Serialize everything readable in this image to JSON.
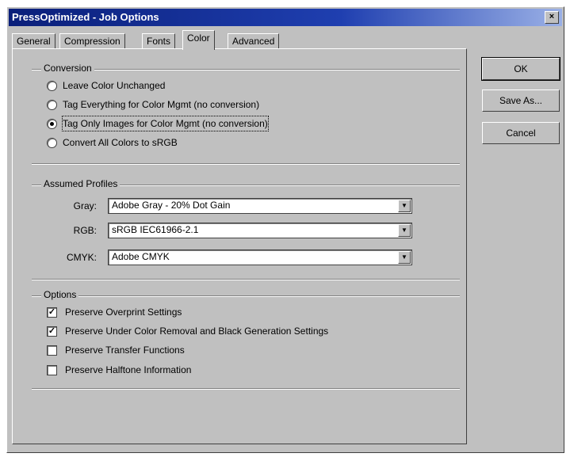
{
  "window": {
    "title": "PressOptimized - Job Options",
    "close_label": "×"
  },
  "tabs": [
    {
      "label": "General"
    },
    {
      "label": "Compression"
    },
    {
      "label": "Fonts"
    },
    {
      "label": "Color"
    },
    {
      "label": "Advanced"
    }
  ],
  "active_tab": "Color",
  "conversion": {
    "group_label": "Conversion",
    "options": [
      {
        "label": "Leave Color Unchanged",
        "selected": false
      },
      {
        "label": "Tag Everything for Color Mgmt (no conversion)",
        "selected": false
      },
      {
        "label": "Tag Only Images for Color Mgmt (no conversion)",
        "selected": true
      },
      {
        "label": "Convert All Colors to sRGB",
        "selected": false
      }
    ]
  },
  "profiles": {
    "group_label": "Assumed Profiles",
    "gray": {
      "label": "Gray:",
      "value": "Adobe Gray - 20% Dot Gain"
    },
    "rgb": {
      "label": "RGB:",
      "value": "sRGB IEC61966-2.1"
    },
    "cmyk": {
      "label": "CMYK:",
      "value": "Adobe CMYK"
    }
  },
  "options": {
    "group_label": "Options",
    "items": [
      {
        "label": "Preserve Overprint Settings",
        "checked": true
      },
      {
        "label": "Preserve Under Color Removal and Black Generation Settings",
        "checked": true
      },
      {
        "label": "Preserve Transfer Functions",
        "checked": false
      },
      {
        "label": "Preserve Halftone Information",
        "checked": false
      }
    ]
  },
  "buttons": {
    "ok": "OK",
    "save_as": "Save As...",
    "cancel": "Cancel"
  }
}
